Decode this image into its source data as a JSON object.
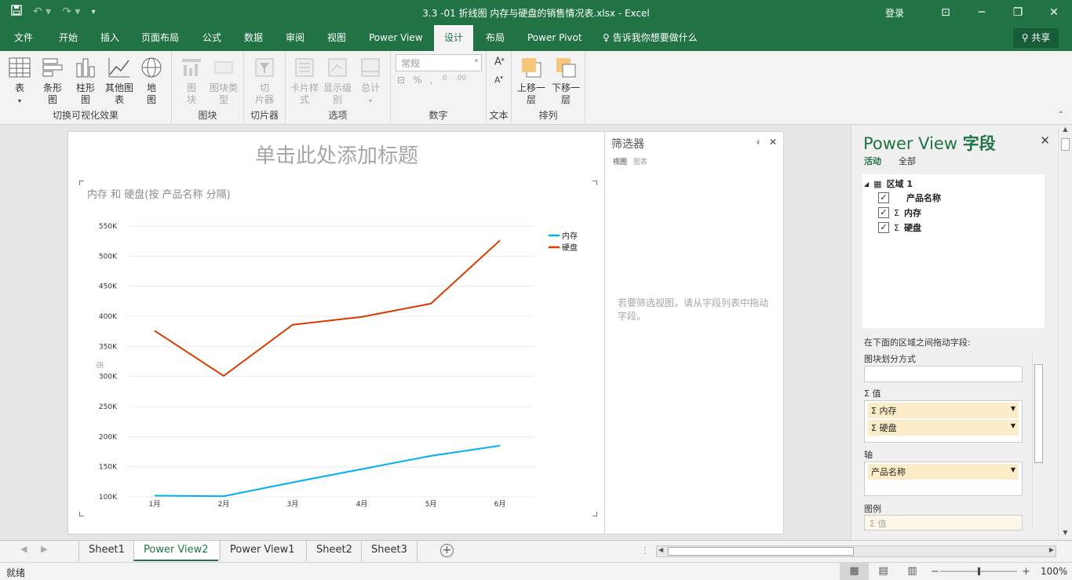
{
  "app": {
    "title": "3.3 -01 折线图 内存与硬盘的销售情况表.xlsx  -  Excel",
    "login": "登录"
  },
  "menu": {
    "tabs": [
      "文件",
      "开始",
      "插入",
      "页面布局",
      "公式",
      "数据",
      "审阅",
      "视图",
      "Power View",
      "设计",
      "布局",
      "Power Pivot"
    ],
    "active_tab": "设计",
    "tell_me": "告诉我你想要做什么",
    "share": "共享"
  },
  "ribbon": {
    "groups": {
      "switch": "切换可视化效果",
      "tiles": "图块",
      "slicer": "切片器",
      "options": "选项",
      "number": "数字",
      "text": "文本",
      "arrange": "排列"
    },
    "buttons": {
      "table": "表",
      "bar": "条形\n图",
      "column": "柱形\n图",
      "other": "其他图\n表",
      "map": "地\n图",
      "tiles": "图\n块",
      "tile_type": "图块类\n型",
      "slicer": "切\n片器",
      "card_style": "卡片样\n式",
      "display_level": "显示级\n别",
      "totals": "总计",
      "bring_forward": "上移一\n层",
      "send_backward": "下移一\n层"
    },
    "number_format": "常规"
  },
  "canvas": {
    "title_placeholder": "单击此处添加标题"
  },
  "filter_pane": {
    "title": "筛选器",
    "tab_view": "视图",
    "tab_chart": "图表",
    "hint": "若要筛选视图，请从字段列表中拖动字段。"
  },
  "chart_data": {
    "type": "line",
    "title": "内存 和 硬盘(按 产品名称 分隔)",
    "categories": [
      "1月",
      "2月",
      "3月",
      "4月",
      "5月",
      "6月"
    ],
    "series": [
      {
        "name": "内存",
        "color": "#00b0f0",
        "values": [
          102000,
          101000,
          124000,
          146000,
          168000,
          185000
        ]
      },
      {
        "name": "硬盘",
        "color": "#d83b01",
        "values": [
          376000,
          301000,
          386000,
          399000,
          421000,
          526000
        ]
      }
    ],
    "yticks": [
      "100K",
      "150K",
      "200K",
      "250K",
      "300K",
      "350K",
      "400K",
      "450K",
      "500K",
      "550K"
    ],
    "ylim": [
      100000,
      550000
    ],
    "ylabel": "币",
    "grid": true,
    "legend": "top-right"
  },
  "field_list": {
    "title_prefix": "Power View ",
    "title_main": "字段",
    "tab_active": "活动",
    "tab_all": "全部",
    "table": "区域 1",
    "fields": [
      {
        "label": "产品名称",
        "checked": true,
        "sigma": false
      },
      {
        "label": "内存",
        "checked": true,
        "sigma": true
      },
      {
        "label": "硬盘",
        "checked": true,
        "sigma": true
      }
    ],
    "drag_hint": "在下面的区域之间拖动字段:",
    "sections": {
      "tile_by": "图块划分方式",
      "values": "Σ 值",
      "axis": "轴",
      "legend": "图例"
    },
    "values_items": [
      "Σ 内存",
      "Σ 硬盘"
    ],
    "axis_items": [
      "产品名称"
    ],
    "legend_placeholder": "Σ 值"
  },
  "sheets": {
    "tabs": [
      "Sheet1",
      "Power View2",
      "Power View1",
      "Sheet2",
      "Sheet3"
    ],
    "active": "Power View2"
  },
  "status": {
    "ready": "就绪",
    "zoom": "100%"
  }
}
